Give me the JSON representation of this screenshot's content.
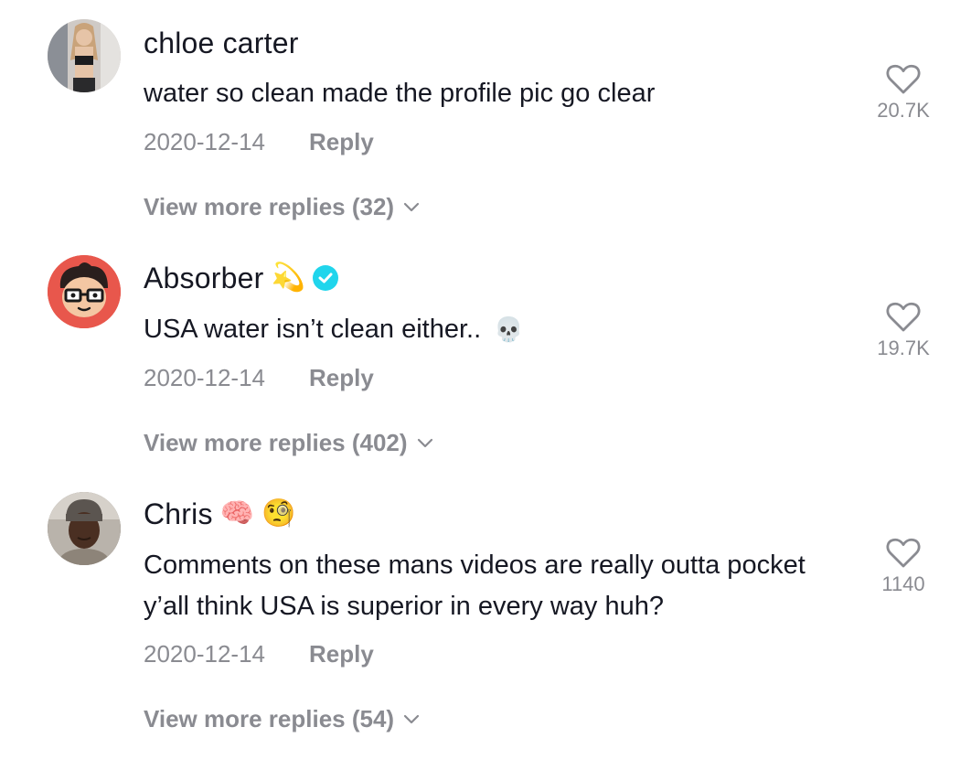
{
  "comments": [
    {
      "username": "chloe carter",
      "badges": [],
      "text": "water so clean made the profile pic go clear",
      "text_emoji": "",
      "date": "2020-12-14",
      "reply_label": "Reply",
      "likes": "20.7K",
      "view_more": "View more replies (32)",
      "avatar": "photo-avatar-woman"
    },
    {
      "username": "Absorber",
      "badges": [
        "💫",
        "verified-badge-icon"
      ],
      "text": "USA water isn’t clean either..",
      "text_emoji": "💀",
      "date": "2020-12-14",
      "reply_label": "Reply",
      "likes": "19.7K",
      "view_more": "View more replies (402)",
      "avatar": "cartoon-avatar-boy-glasses"
    },
    {
      "username": "Chris",
      "badges": [
        "🧠",
        "🧐"
      ],
      "text": "Comments on these mans videos are really outta pocket y’all think USA is superior in every way huh?",
      "text_emoji": "",
      "date": "2020-12-14",
      "reply_label": "Reply",
      "likes": "1140",
      "view_more": "View more replies (54)",
      "avatar": "photo-avatar-man-beanie"
    }
  ],
  "icons": {
    "like": "heart-outline-icon",
    "expand": "chevron-down-icon"
  },
  "colors": {
    "primary_text": "#161823",
    "secondary_text": "#8a8b91",
    "verified": "#20d5ec"
  }
}
